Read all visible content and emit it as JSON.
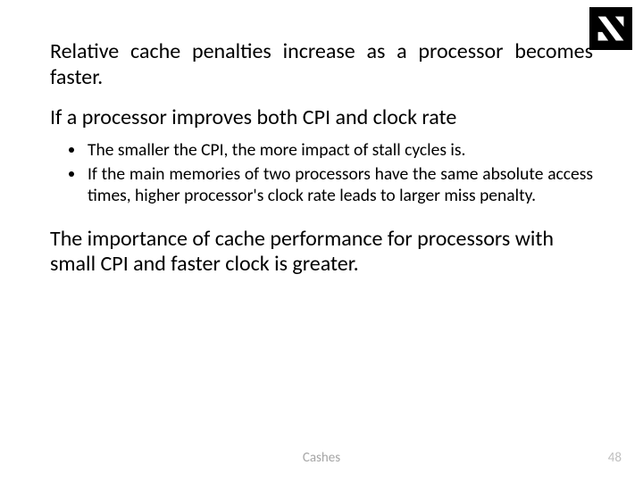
{
  "para1": "Relative cache penalties increase as a processor becomes faster.",
  "para2": "If a processor improves both CPI and clock rate",
  "bullets": [
    "The smaller the CPI, the more impact of stall cycles is.",
    "If the main memories of two processors have the same absolute access times, higher processor's clock rate leads to larger miss penalty."
  ],
  "para3": "The importance of cache performance for processors with small CPI and faster clock is greater.",
  "footer": {
    "title": "Cashes",
    "page": "48"
  }
}
